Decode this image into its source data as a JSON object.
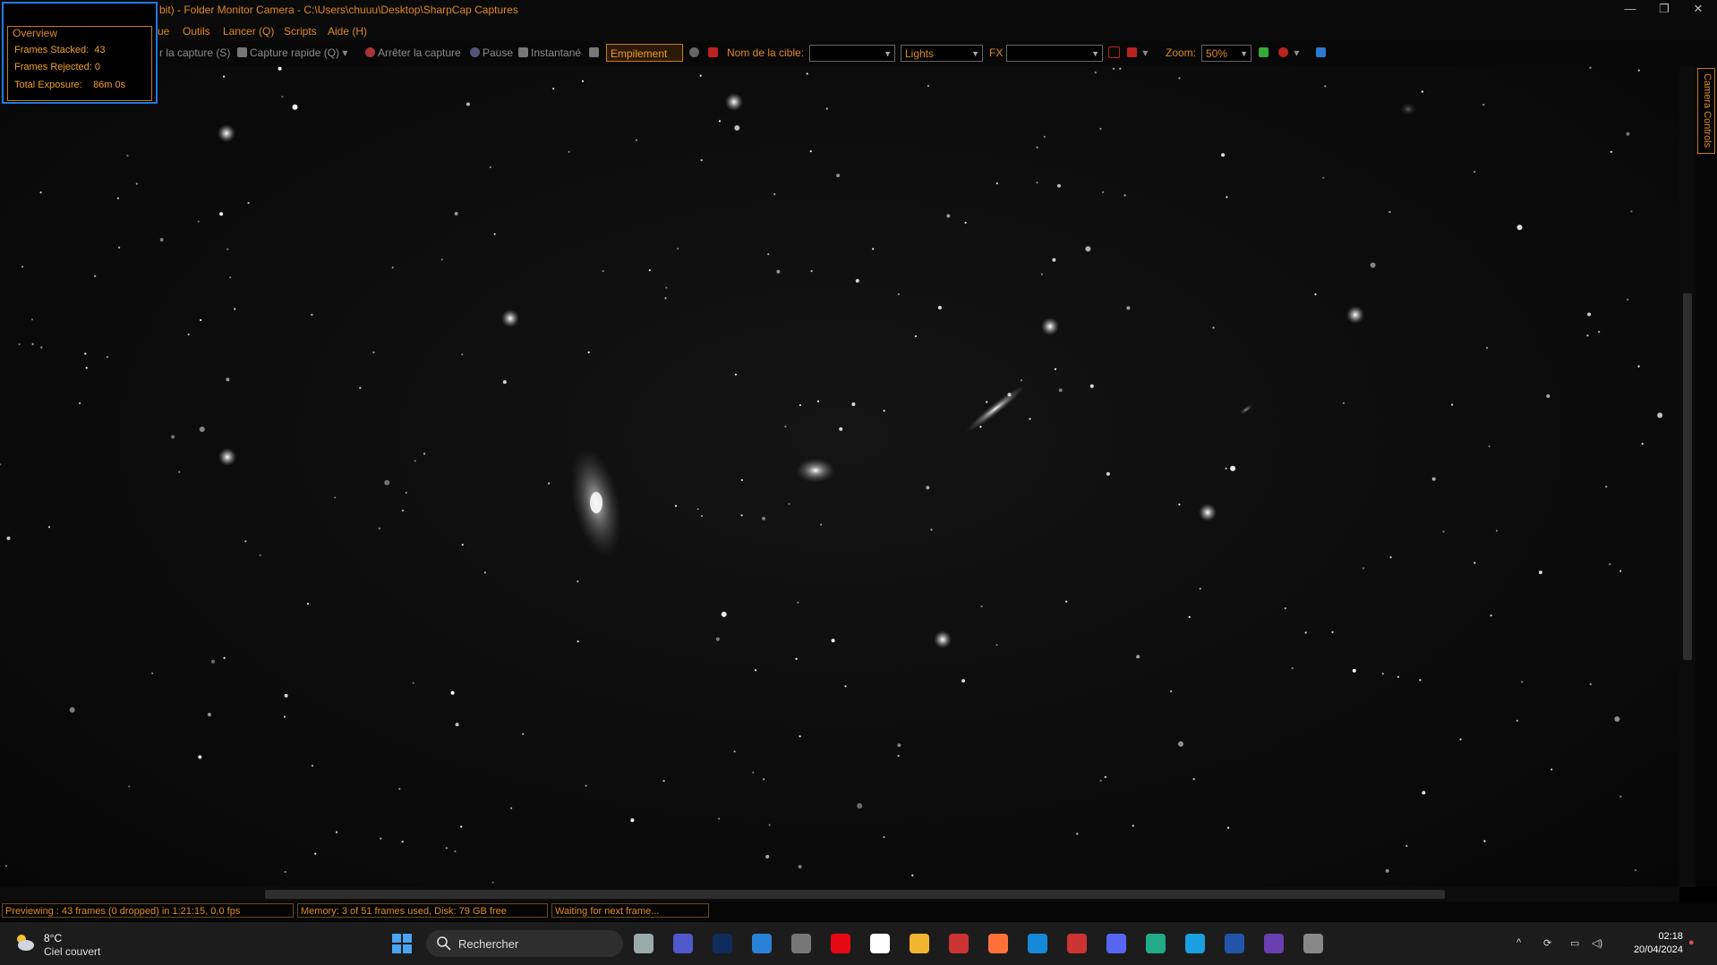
{
  "window": {
    "title": "bit) - Folder Monitor Camera - C:\\Users\\chuuu\\Desktop\\SharpCap Captures",
    "minimize": "—",
    "restore": "❐",
    "close": "✕"
  },
  "menu": {
    "items": [
      "ue",
      "Outils",
      "Lancer (Q)",
      "Scripts",
      "Aide (H)"
    ]
  },
  "toolbar": {
    "start_capture": "r la capture (S)",
    "quick_capture": "Capture rapide (Q)",
    "stop_capture": "Arrêter la capture",
    "pause": "Pause",
    "snapshot": "Instantané",
    "stacking": "Empilement",
    "target_label": "Nom de la cible:",
    "target_value": "",
    "frame_type": "Lights",
    "fx_label": "FX",
    "fx_value": "",
    "zoom_label": "Zoom:",
    "zoom_value": "50%"
  },
  "overview": {
    "title": "Overview",
    "frames_stacked_label": "Frames Stacked:",
    "frames_stacked": "43",
    "frames_rejected_label": "Frames Rejected:",
    "frames_rejected": "0",
    "total_exposure_label": "Total Exposure:",
    "total_exposure": "86m 0s"
  },
  "side_panel": {
    "tab": "Camera Controls"
  },
  "status": {
    "preview": "Previewing : 43 frames (0 dropped) in 1:21:15, 0,0 fps",
    "memory": "Memory: 3 of 51 frames used, Disk: 79 GB free",
    "state": "Waiting for next frame..."
  },
  "taskbar": {
    "temperature": "8°C",
    "weather": "Ciel couvert",
    "search_placeholder": "Rechercher",
    "time": "02:18",
    "date": "20/04/2024",
    "apps": [
      "task-view",
      "teams",
      "photoshop",
      "store",
      "calculator",
      "netflix",
      "plus-app",
      "file-explorer",
      "app-8",
      "firefox",
      "edge",
      "app-12",
      "discord",
      "app-14",
      "app-15",
      "app-16",
      "app-17",
      "app-18"
    ]
  },
  "colors": {
    "accent": "#e08a1f",
    "overview_border": "#1e7ae6",
    "background": "#000000"
  }
}
